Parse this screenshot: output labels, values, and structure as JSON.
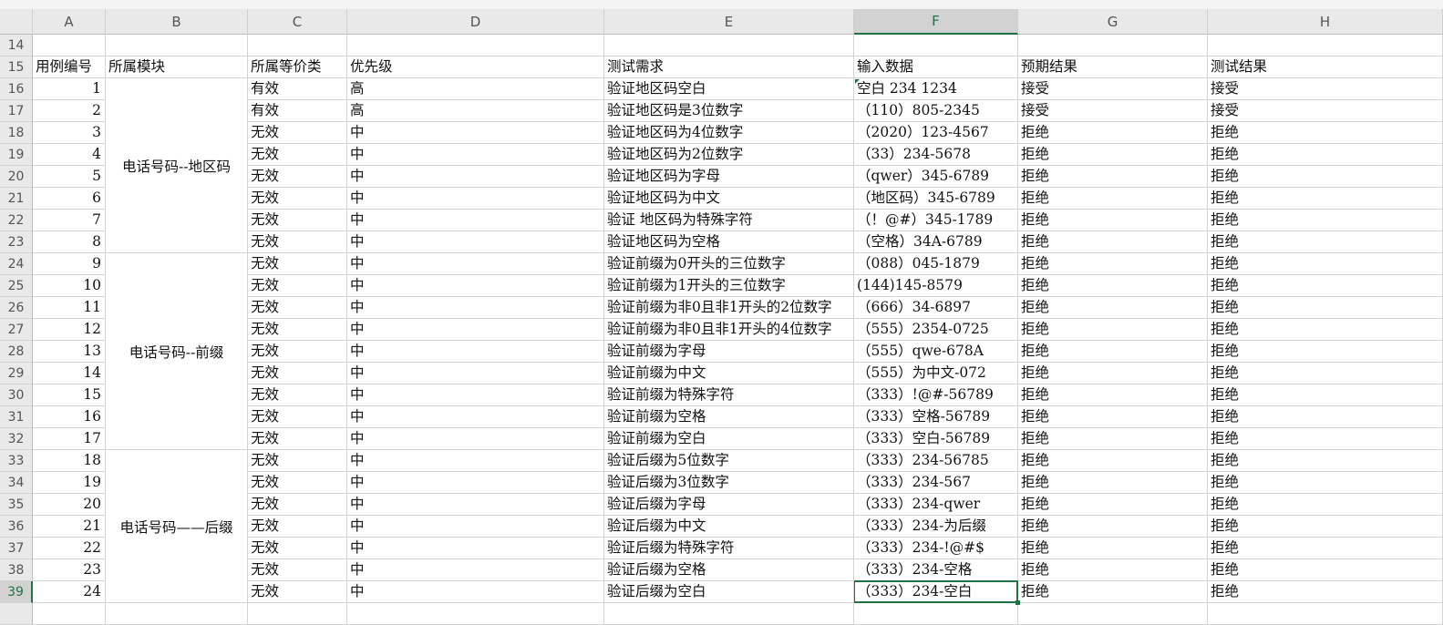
{
  "columns": [
    "A",
    "B",
    "C",
    "D",
    "E",
    "F",
    "G",
    "H"
  ],
  "selected_column": "F",
  "selected_row": "39",
  "top_row_number": "14",
  "header_row": {
    "row": "15",
    "cells": [
      "用例编号",
      "所属模块",
      "所属等价类",
      "优先级",
      "测试需求",
      "输入数据",
      "预期结果",
      "测试结果"
    ]
  },
  "modules": [
    {
      "name": "电话号码--地区码",
      "first_row": 16,
      "last_row": 23
    },
    {
      "name": "电话号码--前缀",
      "first_row": 24,
      "last_row": 32
    },
    {
      "name": "电话号码——后缀",
      "first_row": 33,
      "last_row": 39
    }
  ],
  "rows": [
    {
      "row": "16",
      "id": "1",
      "cls": "有效",
      "pri": "高",
      "req": "验证地区码空白",
      "input": " 空白  234  1234",
      "expected": "接受",
      "actual": "接受"
    },
    {
      "row": "17",
      "id": "2",
      "cls": "有效",
      "pri": "高",
      "req": "验证地区码是3位数字",
      "input": "（110）805-2345",
      "expected": "接受",
      "actual": "接受"
    },
    {
      "row": "18",
      "id": "3",
      "cls": "无效",
      "pri": "中",
      "req": "验证地区码为4位数字",
      "input": "（2020）123-4567",
      "expected": "拒绝",
      "actual": "拒绝"
    },
    {
      "row": "19",
      "id": "4",
      "cls": "无效",
      "pri": "中",
      "req": "验证地区码为2位数字",
      "input": "（33）234-5678",
      "expected": "拒绝",
      "actual": "拒绝"
    },
    {
      "row": "20",
      "id": "5",
      "cls": "无效",
      "pri": "中",
      "req": "验证地区码为字母",
      "input": "（qwer）345-6789",
      "expected": "拒绝",
      "actual": "拒绝"
    },
    {
      "row": "21",
      "id": "6",
      "cls": "无效",
      "pri": "中",
      "req": "验证地区码为中文",
      "input": "（地区码）345-6789",
      "expected": "拒绝",
      "actual": "拒绝"
    },
    {
      "row": "22",
      "id": "7",
      "cls": "无效",
      "pri": "中",
      "req": "验证 地区码为特殊字符",
      "input": "（！@#）345-1789",
      "expected": "拒绝",
      "actual": "拒绝"
    },
    {
      "row": "23",
      "id": "8",
      "cls": "无效",
      "pri": "中",
      "req": "验证地区码为空格",
      "input": "（空格）34A-6789",
      "expected": "拒绝",
      "actual": "拒绝"
    },
    {
      "row": "24",
      "id": "9",
      "cls": "无效",
      "pri": "中",
      "req": "验证前缀为0开头的三位数字",
      "input": "（088）045-1879",
      "expected": "拒绝",
      "actual": "拒绝"
    },
    {
      "row": "25",
      "id": "10",
      "cls": "无效",
      "pri": "中",
      "req": "验证前缀为1开头的三位数字",
      "input": "(144)145-8579",
      "expected": "拒绝",
      "actual": "拒绝"
    },
    {
      "row": "26",
      "id": "11",
      "cls": "无效",
      "pri": "中",
      "req": "验证前缀为非0且非1开头的2位数字",
      "input": "（666）34-6897",
      "expected": "拒绝",
      "actual": "拒绝"
    },
    {
      "row": "27",
      "id": "12",
      "cls": "无效",
      "pri": "中",
      "req": "验证前缀为非0且非1开头的4位数字",
      "input": "（555）2354-0725",
      "expected": "拒绝",
      "actual": "拒绝"
    },
    {
      "row": "28",
      "id": "13",
      "cls": "无效",
      "pri": "中",
      "req": "验证前缀为字母",
      "input": "（555）qwe-678A",
      "expected": "拒绝",
      "actual": "拒绝"
    },
    {
      "row": "29",
      "id": "14",
      "cls": "无效",
      "pri": "中",
      "req": "验证前缀为中文",
      "input": "（555）为中文-072",
      "expected": "拒绝",
      "actual": "拒绝"
    },
    {
      "row": "30",
      "id": "15",
      "cls": "无效",
      "pri": "中",
      "req": "验证前缀为特殊字符",
      "input": "（333）!@#-56789",
      "expected": "拒绝",
      "actual": "拒绝"
    },
    {
      "row": "31",
      "id": "16",
      "cls": "无效",
      "pri": "中",
      "req": "验证前缀为空格",
      "input": "（333）空格-56789",
      "expected": "拒绝",
      "actual": "拒绝"
    },
    {
      "row": "32",
      "id": "17",
      "cls": "无效",
      "pri": "中",
      "req": "验证前缀为空白",
      "input": "（333）空白-56789",
      "expected": "拒绝",
      "actual": "拒绝"
    },
    {
      "row": "33",
      "id": "18",
      "cls": "无效",
      "pri": "中",
      "req": "验证后缀为5位数字",
      "input": "（333）234-56785",
      "expected": "拒绝",
      "actual": "拒绝"
    },
    {
      "row": "34",
      "id": "19",
      "cls": "无效",
      "pri": "中",
      "req": "验证后缀为3位数字",
      "input": "（333）234-567",
      "expected": "拒绝",
      "actual": "拒绝"
    },
    {
      "row": "35",
      "id": "20",
      "cls": "无效",
      "pri": "中",
      "req": "验证后缀为字母",
      "input": "（333）234-qwer",
      "expected": "拒绝",
      "actual": "拒绝"
    },
    {
      "row": "36",
      "id": "21",
      "cls": "无效",
      "pri": "中",
      "req": "验证后缀为中文",
      "input": "（333）234-为后缀",
      "expected": "拒绝",
      "actual": "拒绝"
    },
    {
      "row": "37",
      "id": "22",
      "cls": "无效",
      "pri": "中",
      "req": "验证后缀为特殊字符",
      "input": "（333）234-!@#$",
      "expected": "拒绝",
      "actual": "拒绝"
    },
    {
      "row": "38",
      "id": "23",
      "cls": "无效",
      "pri": "中",
      "req": "验证后缀为空格",
      "input": "（333）234-空格",
      "expected": "拒绝",
      "actual": "拒绝"
    },
    {
      "row": "39",
      "id": "24",
      "cls": "无效",
      "pri": "中",
      "req": "验证后缀为空白",
      "input": "（333）234-空白",
      "expected": "拒绝",
      "actual": "拒绝"
    }
  ],
  "colors": {
    "accent": "#217346",
    "header_bg": "#e9e9e9",
    "grid": "#d4d4d4"
  }
}
